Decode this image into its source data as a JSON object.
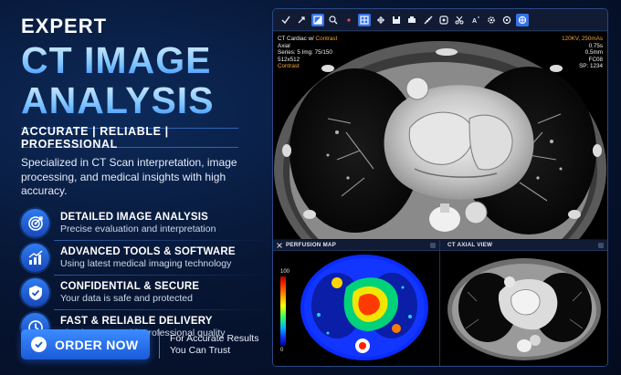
{
  "hero": {
    "eyebrow": "EXPERT",
    "title_line1": "CT IMAGE",
    "title_line2": "ANALYSIS",
    "tagline": "ACCURATE | RELIABLE | PROFESSIONAL",
    "description": "Specialized in CT Scan interpretation, image processing, and medical insights with high accuracy."
  },
  "features": [
    {
      "icon": "target-icon",
      "title": "DETAILED IMAGE ANALYSIS",
      "subtitle": "Precise evaluation and interpretation"
    },
    {
      "icon": "chart-growth-icon",
      "title": "ADVANCED TOOLS & SOFTWARE",
      "subtitle": "Using latest medical imaging technology"
    },
    {
      "icon": "shield-check-icon",
      "title": "CONFIDENTIAL & SECURE",
      "subtitle": "Your data is safe and protected"
    },
    {
      "icon": "clock-icon",
      "title": "FAST & RELIABLE DELIVERY",
      "subtitle": "Timely reports with professional quality"
    }
  ],
  "cta": {
    "button_label": "ORDER NOW",
    "note_line1": "For Accurate Results",
    "note_line2": "You Can Trust"
  },
  "viewer": {
    "toolbar_icons": [
      "pointer-icon",
      "move-icon",
      "window-level-icon",
      "magnify-icon",
      "dot-icon",
      "layout-icon",
      "crosshair-icon",
      "save-icon",
      "print-icon",
      "measure-icon",
      "roi-icon",
      "scissors-icon",
      "annotation-icon",
      "settings-icon",
      "target-icon",
      "3d-icon"
    ],
    "overlay_left": {
      "line1_a": "CT Cardiac w/ ",
      "line1_b": "Contrast",
      "line2": "Axial",
      "line3": "Series: 5 Img: 75/150",
      "line4": "512x512",
      "line5": "Contrast"
    },
    "overlay_right": {
      "line1": "120KV, 250mAs",
      "line2": "0.75s",
      "line3": "0.5mm",
      "line4": "FC08",
      "line5": "SP: 1234"
    },
    "perfusion": {
      "title": "PERFUSION MAP",
      "scale_max": "100",
      "scale_min": "0"
    },
    "axial": {
      "title": "CT AXIAL VIEW"
    }
  },
  "colors": {
    "accent": "#2f7cf0",
    "overlay_orange": "#f4a23c",
    "background": "#071634"
  }
}
